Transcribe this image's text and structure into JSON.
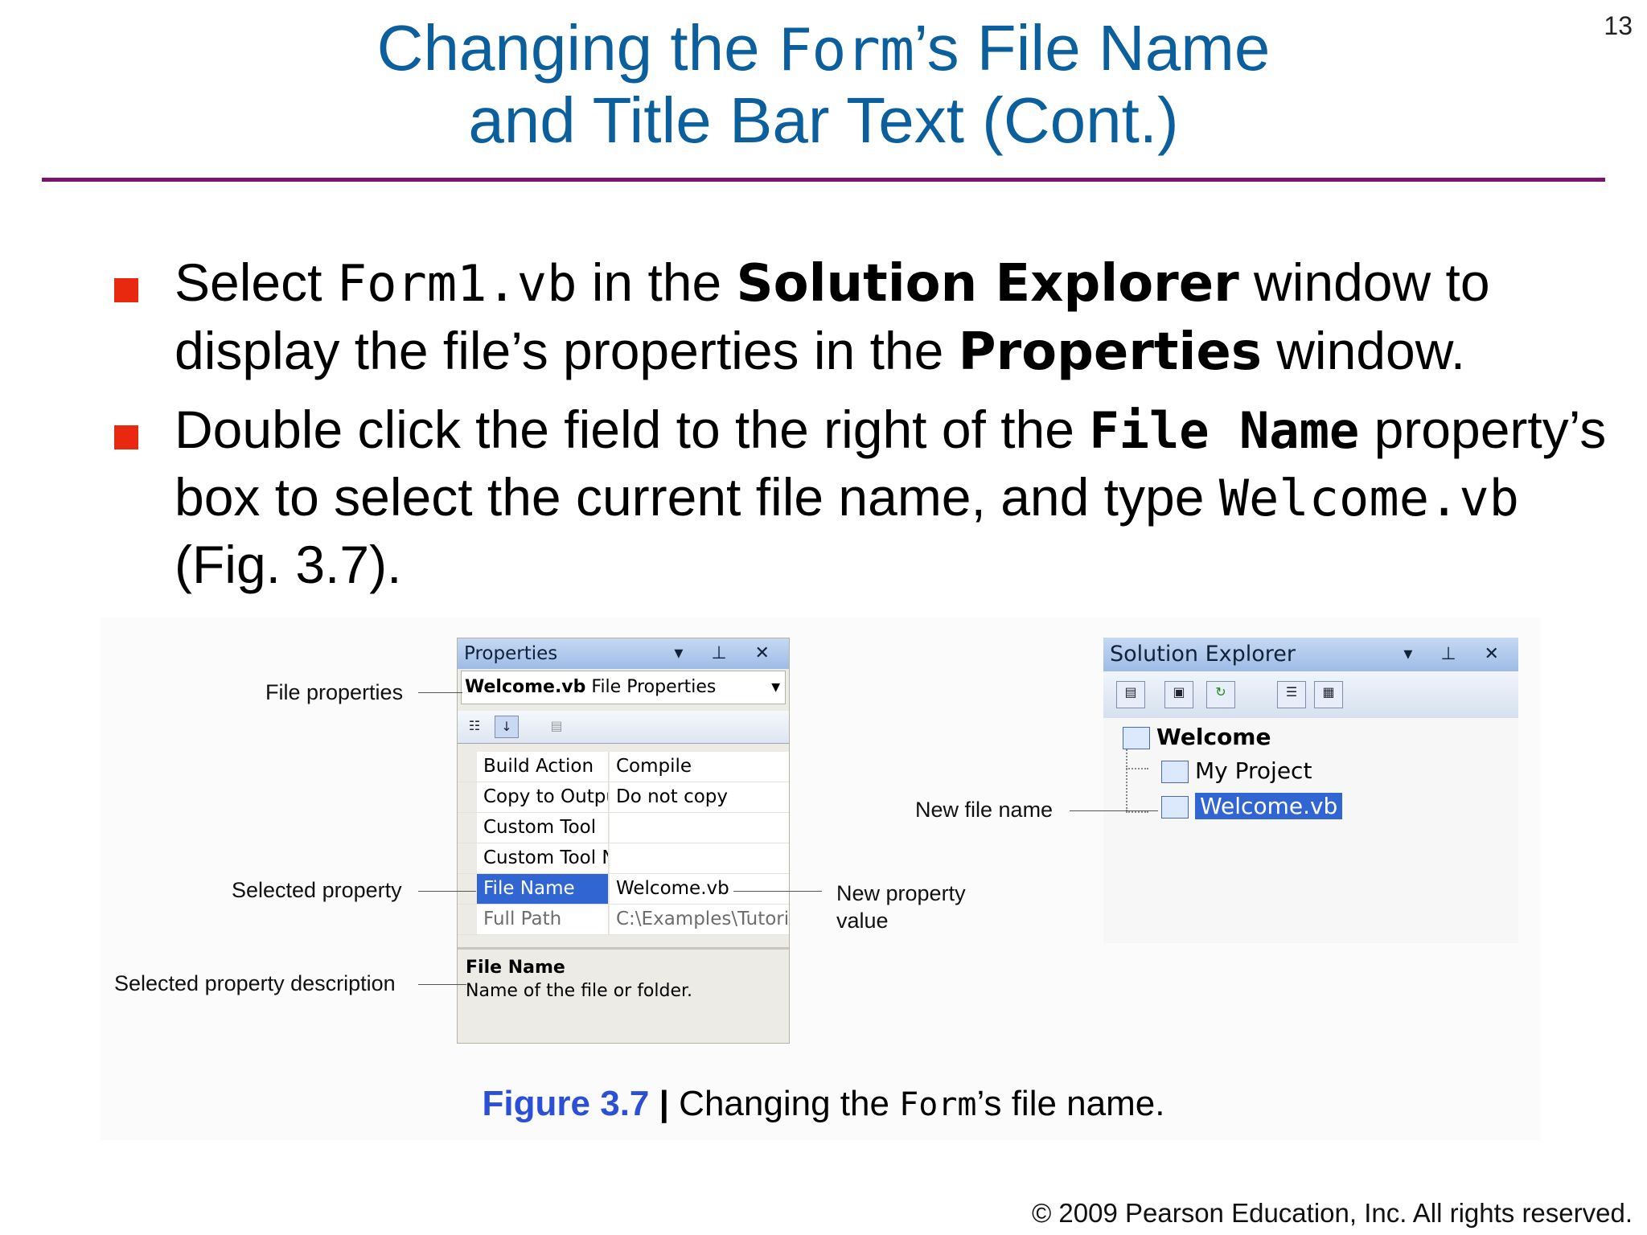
{
  "slide": {
    "page_number": "13",
    "title_line1_a": "Changing the ",
    "title_line1_code": "Form",
    "title_line1_b": "’s File Name",
    "title_line2": "and Title Bar Text (Cont.)",
    "accent_color": "#7a1470",
    "title_color": "#0b5f9c",
    "bullet_color": "#e8280f"
  },
  "bullets": [
    {
      "t1": "Select ",
      "code1": "Form1.vb",
      "t2": " in the ",
      "bold1": "Solution Explorer",
      "t3": " window to display the file’s properties in the ",
      "bold2": "Properties",
      "t4": " window."
    },
    {
      "t1": "Double click the field to the right of the ",
      "code1": "File Name",
      "t2": " property’s box to select the current file name, and type ",
      "code2": "Welcome.vb",
      "t3": " (Fig. 3.7)."
    }
  ],
  "properties_window": {
    "title": "Properties",
    "controls": "▾ ⊥ ✕",
    "object_name": "Welcome.vb",
    "object_type": "File Properties",
    "rows": [
      {
        "key": "Build Action",
        "value": "Compile"
      },
      {
        "key": "Copy to Output",
        "value": "Do not copy"
      },
      {
        "key": "Custom Tool",
        "value": ""
      },
      {
        "key": "Custom Tool N",
        "value": ""
      },
      {
        "key": "File Name",
        "value": "Welcome.vb"
      },
      {
        "key": "Full Path",
        "value": "C:\\Examples\\Tutoria"
      }
    ],
    "description_title": "File Name",
    "description_text": "Name of the file or folder."
  },
  "solution_explorer": {
    "title": "Solution Explorer",
    "controls": "▾ ⊥ ✕",
    "root": "Welcome",
    "child1": "My Project",
    "child2": "Welcome.vb"
  },
  "callouts": {
    "file_properties": "File properties",
    "selected_property": "Selected property",
    "selected_property_description": "Selected property description",
    "new_property_value_1": "New property",
    "new_property_value_2": "value",
    "new_file_name": "New file name"
  },
  "caption": {
    "figure": "Figure 3.7",
    "separator": "|",
    "text_a": " Changing the ",
    "code": "Form",
    "text_b": "’s file name."
  },
  "copyright": "© 2009 Pearson Education, Inc.  All rights reserved."
}
